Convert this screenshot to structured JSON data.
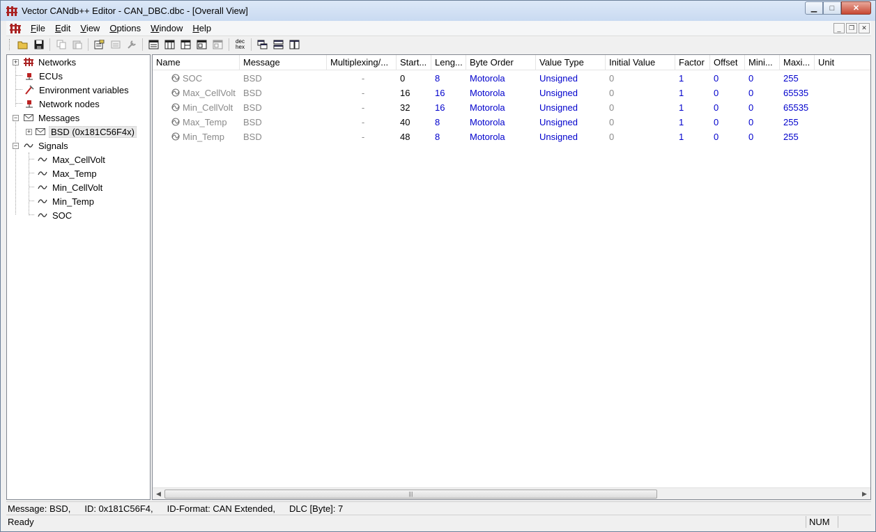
{
  "window": {
    "title": "Vector CANdb++ Editor - CAN_DBC.dbc - [Overall View]",
    "min_icon": "minimize-icon",
    "max_icon": "maximize-icon",
    "close_icon": "close-icon"
  },
  "menu": {
    "items": [
      {
        "label": "File",
        "accel": "F"
      },
      {
        "label": "Edit",
        "accel": "E"
      },
      {
        "label": "View",
        "accel": "V"
      },
      {
        "label": "Options",
        "accel": "O"
      },
      {
        "label": "Window",
        "accel": "W"
      },
      {
        "label": "Help",
        "accel": "H"
      }
    ]
  },
  "toolbar": {
    "dechex_top": "dec",
    "dechex_bottom": "hex"
  },
  "tree": {
    "items": [
      {
        "label": "Networks",
        "icon": "network-icon"
      },
      {
        "label": "ECUs",
        "icon": "ecu-icon"
      },
      {
        "label": "Environment variables",
        "icon": "env-var-icon"
      },
      {
        "label": "Network nodes",
        "icon": "network-node-icon"
      },
      {
        "label": "Messages",
        "icon": "message-icon"
      },
      {
        "label": "BSD (0x181C56F4x)",
        "icon": "message-icon"
      },
      {
        "label": "Signals",
        "icon": "signal-icon"
      },
      {
        "label": "Max_CellVolt",
        "icon": "signal-icon"
      },
      {
        "label": "Max_Temp",
        "icon": "signal-icon"
      },
      {
        "label": "Min_CellVolt",
        "icon": "signal-icon"
      },
      {
        "label": "Min_Temp",
        "icon": "signal-icon"
      },
      {
        "label": "SOC",
        "icon": "signal-icon"
      }
    ]
  },
  "grid": {
    "columns": [
      "Name",
      "Message",
      "Multiplexing/...",
      "Start...",
      "Leng...",
      "Byte Order",
      "Value Type",
      "Initial Value",
      "Factor",
      "Offset",
      "Mini...",
      "Maxi...",
      "Unit"
    ],
    "rows": [
      {
        "name": "SOC",
        "message": "BSD",
        "mux": "-",
        "start": "0",
        "length": "8",
        "byte_order": "Motorola",
        "value_type": "Unsigned",
        "initial": "0",
        "factor": "1",
        "offset": "0",
        "min": "0",
        "max": "255",
        "unit": ""
      },
      {
        "name": "Max_CellVolt",
        "message": "BSD",
        "mux": "-",
        "start": "16",
        "length": "16",
        "byte_order": "Motorola",
        "value_type": "Unsigned",
        "initial": "0",
        "factor": "1",
        "offset": "0",
        "min": "0",
        "max": "65535",
        "unit": ""
      },
      {
        "name": "Min_CellVolt",
        "message": "BSD",
        "mux": "-",
        "start": "32",
        "length": "16",
        "byte_order": "Motorola",
        "value_type": "Unsigned",
        "initial": "0",
        "factor": "1",
        "offset": "0",
        "min": "0",
        "max": "65535",
        "unit": ""
      },
      {
        "name": "Max_Temp",
        "message": "BSD",
        "mux": "-",
        "start": "40",
        "length": "8",
        "byte_order": "Motorola",
        "value_type": "Unsigned",
        "initial": "0",
        "factor": "1",
        "offset": "0",
        "min": "0",
        "max": "255",
        "unit": ""
      },
      {
        "name": "Min_Temp",
        "message": "BSD",
        "mux": "-",
        "start": "48",
        "length": "8",
        "byte_order": "Motorola",
        "value_type": "Unsigned",
        "initial": "0",
        "factor": "1",
        "offset": "0",
        "min": "0",
        "max": "255",
        "unit": ""
      }
    ]
  },
  "status": {
    "message": "Message: BSD,",
    "id": "ID: 0x181C56F4,",
    "id_format": "ID-Format: CAN Extended,",
    "dlc": "DLC [Byte]: 7",
    "ready": "Ready",
    "num": "NUM"
  },
  "colors": {
    "blue_value": "#0000cc",
    "gray_value": "#8a8a8a"
  }
}
